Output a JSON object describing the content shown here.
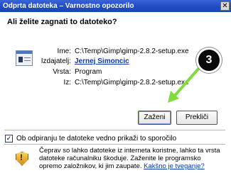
{
  "window": {
    "title": "Odprta datoteka – Varnostno opozorilo",
    "close_glyph": "✕"
  },
  "question": "Ali želite zagnati to datoteko?",
  "file_info": {
    "name_label": "Ime:",
    "name_value": "C:\\Temp\\Gimp\\gimp-2.8.2-setup.exe",
    "publisher_label": "Izdajatelj:",
    "publisher_value": "Jernej Simoncic",
    "type_label": "Vrsta:",
    "type_value": "Program",
    "from_label": "Iz:",
    "from_value": "C:\\Temp\\Gimp\\gimp-2.8.2-setup.exe"
  },
  "buttons": {
    "run": "Zaženi",
    "cancel": "Prekliči"
  },
  "checkbox": {
    "checked": true,
    "mark": "✓",
    "label": "Ob odpiranju te datoteke vedno prikaži to sporočilo"
  },
  "warning": {
    "text": "Čeprav so lahko datoteke iz interneta koristne, lahko ta vrsta datoteke računalniku škoduje. Zaženite le programsko opremo založnikov, ki jim zaupate.",
    "link": "Kakšno je tveganje?"
  },
  "annotation": {
    "step_number": "3",
    "color": "#7fdc3a"
  }
}
